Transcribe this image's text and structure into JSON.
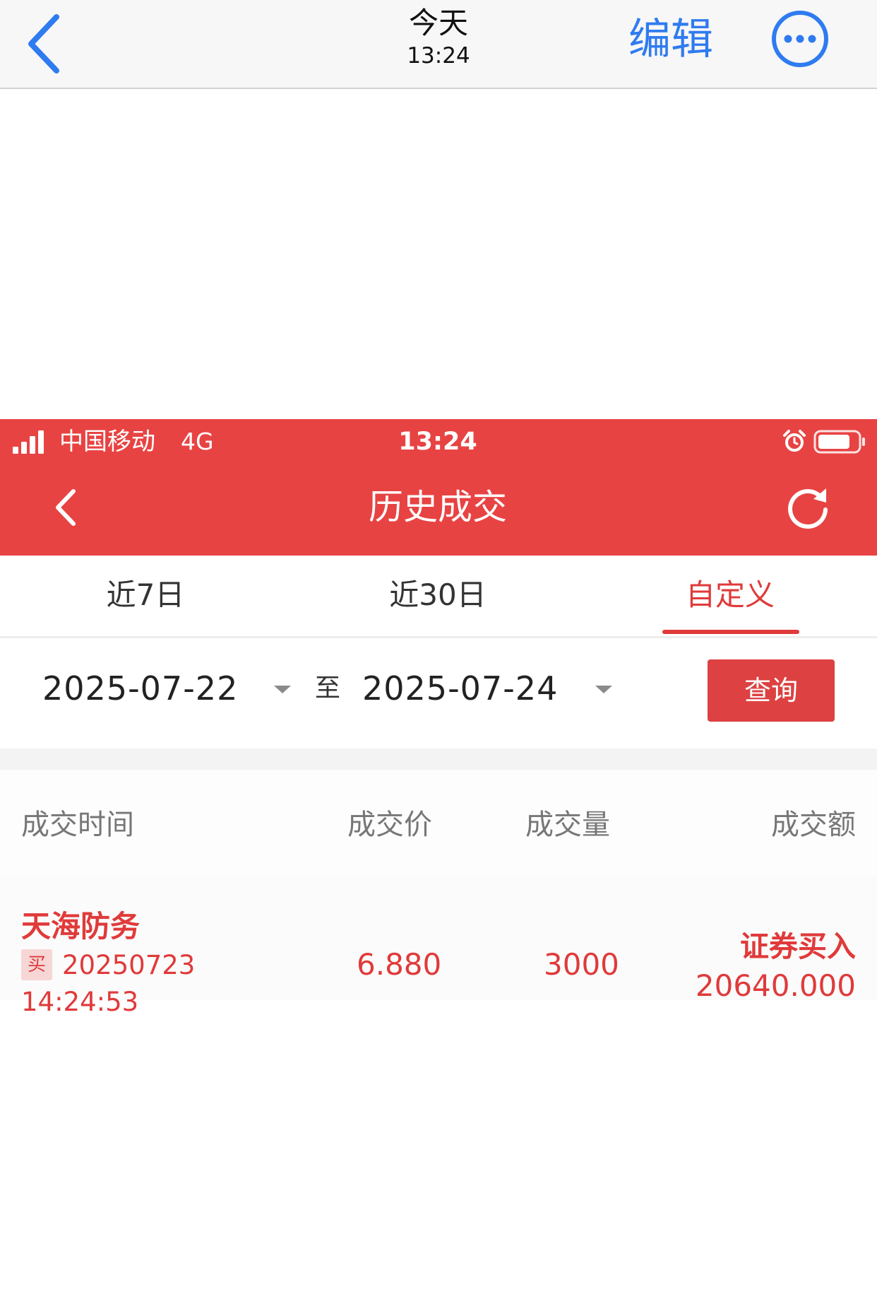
{
  "viewer": {
    "title": "今天",
    "time": "13:24",
    "edit_label": "编辑",
    "back_icon": "chevron-left-icon",
    "more_icon": "ellipsis-circle-icon",
    "accent_color": "#2f7bf0"
  },
  "status_bar": {
    "carrier": "中国移动",
    "network": "4G",
    "time": "13:24",
    "signal_icon": "signal-bars-icon",
    "alarm_icon": "alarm-clock-icon",
    "battery_icon": "battery-icon"
  },
  "nav": {
    "title": "历史成交",
    "back_icon": "chevron-left-icon",
    "refresh_icon": "refresh-icon",
    "bg_color": "#e84343"
  },
  "tabs": [
    {
      "label": "近7日",
      "active": false
    },
    {
      "label": "近30日",
      "active": false
    },
    {
      "label": "自定义",
      "active": true
    }
  ],
  "filter": {
    "start_date": "2025-07-22",
    "separator": "至",
    "end_date": "2025-07-24",
    "query_label": "查询"
  },
  "table": {
    "columns": [
      "成交时间",
      "成交价",
      "成交量",
      "成交额"
    ],
    "rows": [
      {
        "name": "天海防务",
        "side_tag": "买",
        "date": "20250723",
        "time": "14:24:53",
        "price": "6.880",
        "quantity": "3000",
        "direction": "证券买入",
        "amount": "20640.000"
      }
    ]
  },
  "colors": {
    "red": "#e03a3a",
    "header_red": "#e84343",
    "ios_blue": "#2f7bf0"
  }
}
